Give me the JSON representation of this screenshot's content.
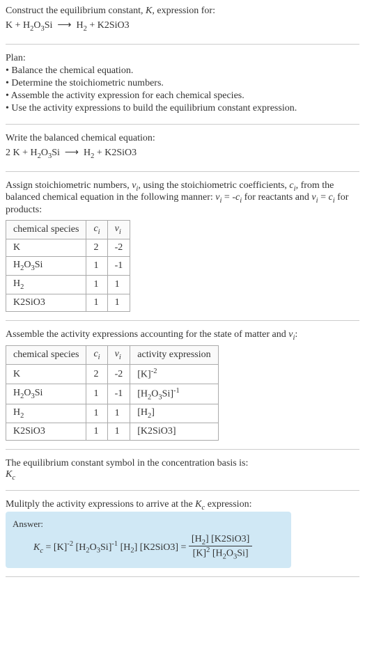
{
  "intro": {
    "line1": "Construct the equilibrium constant, K, expression for:",
    "line2": "K + H₂O₃Si ⟶ H₂ + K2SiO3"
  },
  "plan": {
    "heading": "Plan:",
    "items": [
      "• Balance the chemical equation.",
      "• Determine the stoichiometric numbers.",
      "• Assemble the activity expression for each chemical species.",
      "• Use the activity expressions to build the equilibrium constant expression."
    ]
  },
  "balanced": {
    "heading": "Write the balanced chemical equation:",
    "equation": "2 K + H₂O₃Si ⟶ H₂ + K2SiO3"
  },
  "stoich": {
    "heading_part1": "Assign stoichiometric numbers, ",
    "heading_part2": ", using the stoichiometric coefficients, ",
    "heading_part3": ", from the balanced chemical equation in the following manner: ",
    "heading_part4": " for reactants and ",
    "heading_part5": " for products:",
    "table": {
      "headers": [
        "chemical species",
        "cᵢ",
        "νᵢ"
      ],
      "rows": [
        [
          "K",
          "2",
          "-2"
        ],
        [
          "H₂O₃Si",
          "1",
          "-1"
        ],
        [
          "H₂",
          "1",
          "1"
        ],
        [
          "K2SiO3",
          "1",
          "1"
        ]
      ]
    }
  },
  "activity": {
    "heading": "Assemble the activity expressions accounting for the state of matter and νᵢ:",
    "table": {
      "headers": [
        "chemical species",
        "cᵢ",
        "νᵢ",
        "activity expression"
      ],
      "rows": [
        {
          "species": "K",
          "ci": "2",
          "vi": "-2",
          "expr": "[K]⁻²"
        },
        {
          "species": "H₂O₃Si",
          "ci": "1",
          "vi": "-1",
          "expr": "[H₂O₃Si]⁻¹"
        },
        {
          "species": "H₂",
          "ci": "1",
          "vi": "1",
          "expr": "[H₂]"
        },
        {
          "species": "K2SiO3",
          "ci": "1",
          "vi": "1",
          "expr": "[K2SiO3]"
        }
      ]
    }
  },
  "symbol": {
    "line1": "The equilibrium constant symbol in the concentration basis is:",
    "line2": "K_c"
  },
  "multiply": {
    "heading": "Mulitply the activity expressions to arrive at the K_c expression:"
  },
  "answer": {
    "label": "Answer:",
    "lhs": "K_c = [K]⁻² [H₂O₃Si]⁻¹ [H₂] [K2SiO3] = ",
    "num": "[H₂] [K2SiO3]",
    "den": "[K]² [H₂O₃Si]"
  }
}
